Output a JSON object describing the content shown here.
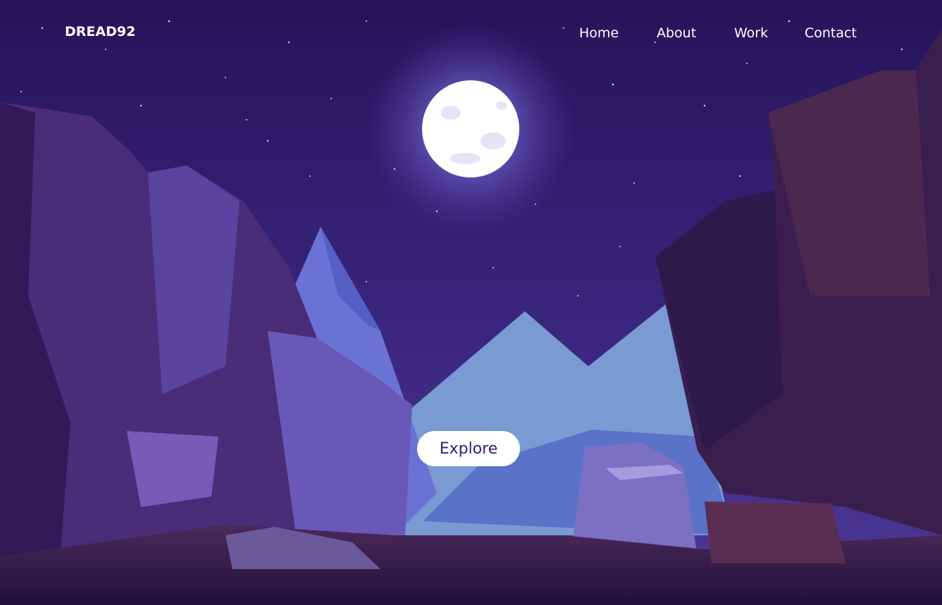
{
  "header": {
    "logo": "DREAD92",
    "nav": [
      {
        "label": "Home"
      },
      {
        "label": "About"
      },
      {
        "label": "Work"
      },
      {
        "label": "Contact"
      }
    ]
  },
  "hero": {
    "cta_label": "Explore"
  },
  "colors": {
    "sky_top": "#2a1660",
    "sky_bottom": "#4a3590",
    "moon": "#ffffff",
    "moon_glow": "#8a7cf0",
    "cliff_dark": "#3a1f5c",
    "mountain_light": "#7a9ad4",
    "button_text": "#3b1a6e"
  }
}
